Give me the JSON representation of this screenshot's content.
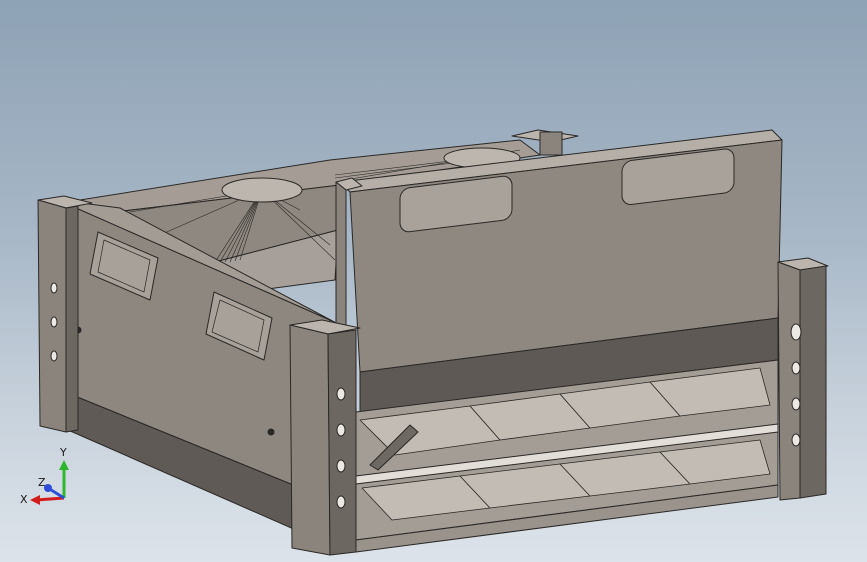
{
  "viewport": {
    "model": "screen-box-assembly"
  },
  "triad": {
    "x_label": "X",
    "y_label": "Y",
    "z_label": "Z",
    "x_color": "#d21d1d",
    "y_color": "#2fb52f",
    "z_color": "#2d4fd8"
  },
  "colors": {
    "metal_light": "#b9b2aa",
    "metal_mid": "#9a928a",
    "metal_dark": "#6e6962",
    "edge": "#2a2826"
  }
}
